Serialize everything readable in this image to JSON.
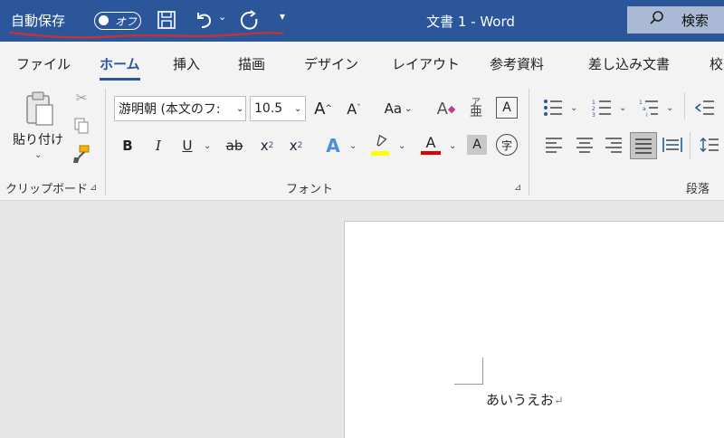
{
  "titlebar": {
    "autosave_label": "自動保存",
    "toggle_text": "オフ",
    "doc_title": "文書 1  -  Word",
    "search_label": "検索",
    "colors": {
      "background": "#2b579a",
      "annotation": "#d0312d"
    }
  },
  "tabs": [
    {
      "label": "ファイル"
    },
    {
      "label": "ホーム",
      "active": true
    },
    {
      "label": "挿入"
    },
    {
      "label": "描画"
    },
    {
      "label": "デザイン"
    },
    {
      "label": "レイアウト"
    },
    {
      "label": "参考資料"
    },
    {
      "label": "差し込み文書"
    },
    {
      "label": "校"
    }
  ],
  "clipboard": {
    "paste_label": "貼り付け",
    "group_label": "クリップボード"
  },
  "font": {
    "font_name": "游明朝 (本文のフ:",
    "font_size": "10.5",
    "case_label": "Aa",
    "group_label": "フォント",
    "highlight_color": "#ffff00",
    "font_color": "#e00000"
  },
  "paragraph": {
    "group_label": "段落"
  },
  "document": {
    "text": "あいうえお",
    "para_mark": "↵"
  }
}
